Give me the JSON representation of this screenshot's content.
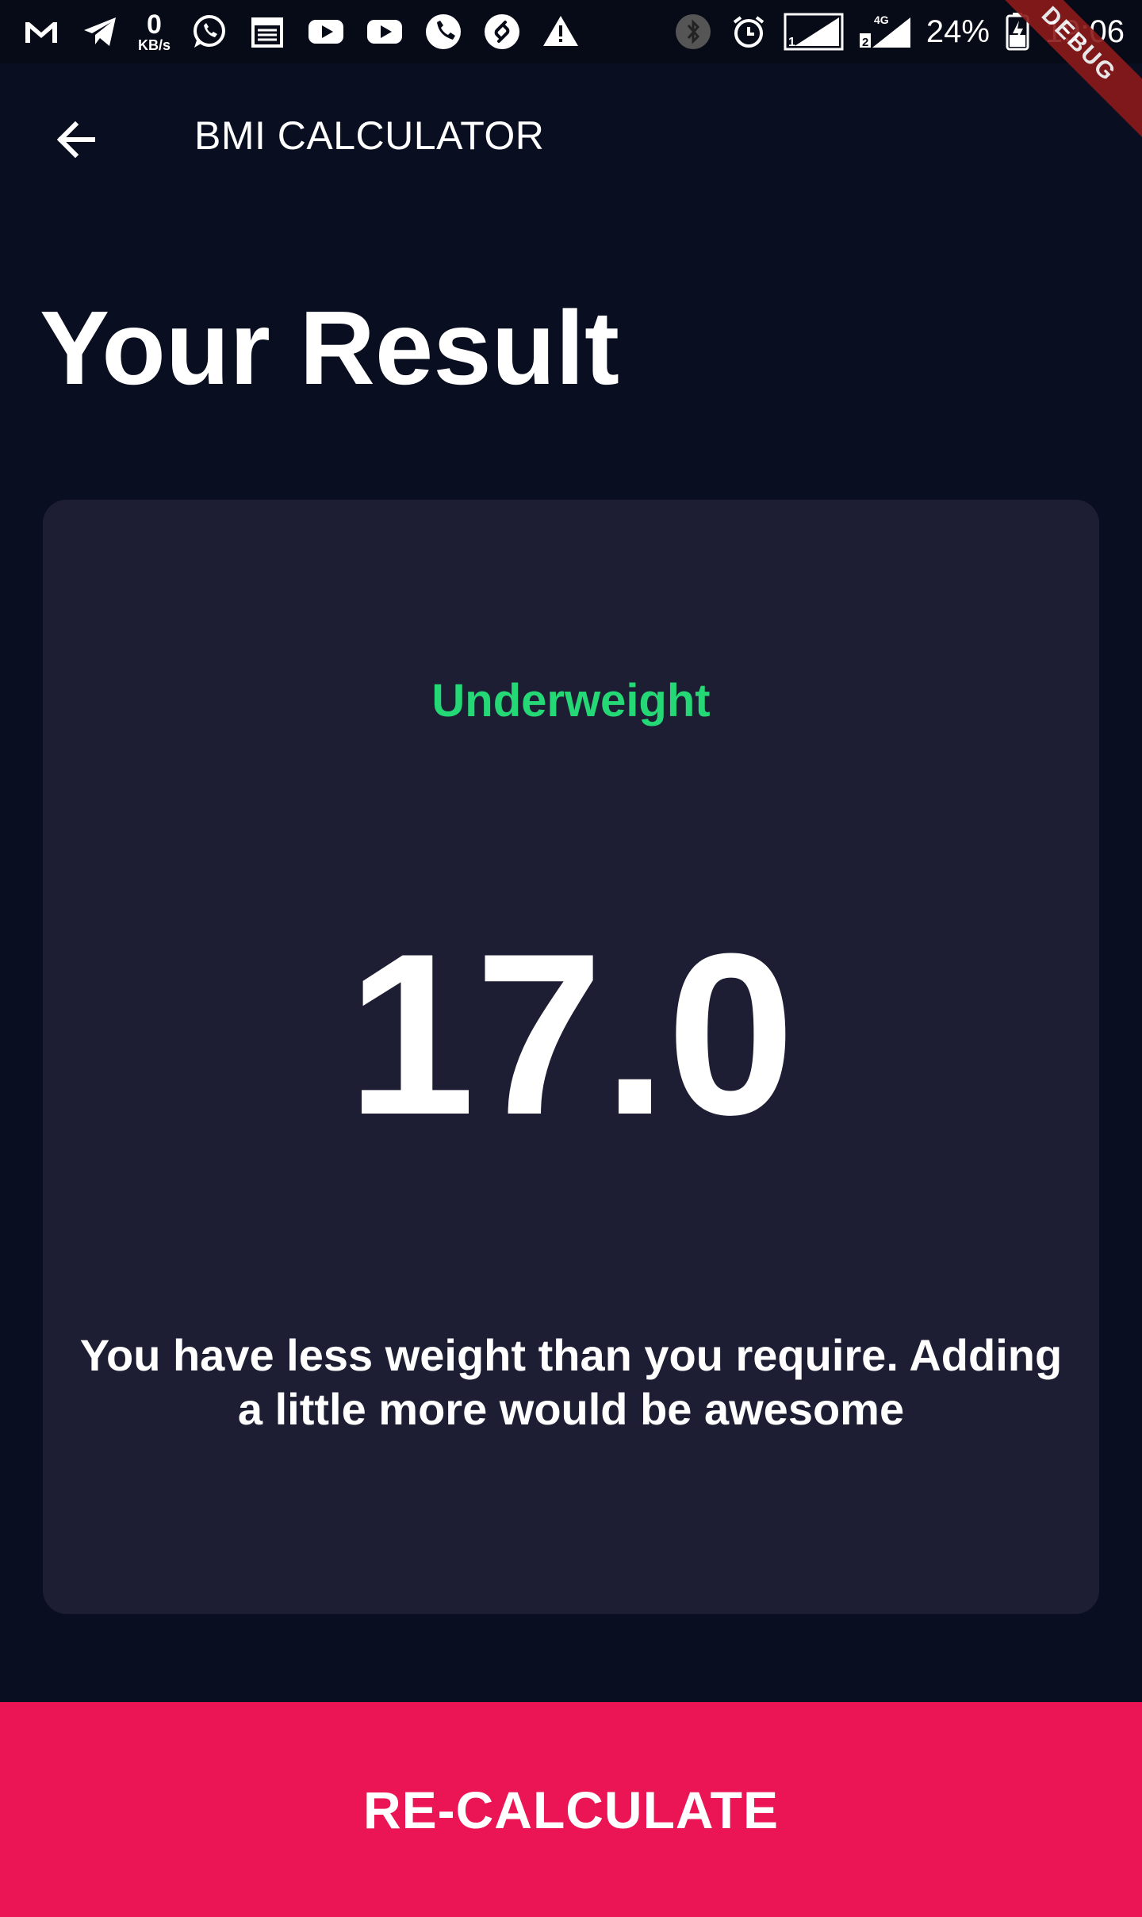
{
  "status_bar": {
    "data_speed_value": "0",
    "data_speed_unit": "KB/s",
    "battery": "24%",
    "time": "19:06",
    "left_icons": [
      "gmail-icon",
      "telegram-icon",
      "whatsapp-icon",
      "calendar-icon",
      "youtube-icon",
      "youtube-icon",
      "phone-icon",
      "shazam-icon",
      "warning-icon"
    ],
    "right_icons": [
      "bluetooth-icon",
      "alarm-icon",
      "signal-sim1-icon",
      "signal-sim2-icon",
      "battery-charging-icon"
    ],
    "network_label": "4G"
  },
  "debug_banner": "DEBUG",
  "app_bar": {
    "title": "BMI CALCULATOR",
    "back_icon": "arrow-back-icon"
  },
  "page": {
    "heading": "Your Result"
  },
  "result": {
    "status": "Underweight",
    "bmi": "17.0",
    "advice": "You have less weight than you require. Adding a little more would be awesome"
  },
  "actions": {
    "recalculate_label": "RE-CALCULATE"
  },
  "colors": {
    "background": "#0A0E21",
    "card": "#1D1E33",
    "status_green": "#24D876",
    "accent_pink": "#EB1555"
  }
}
